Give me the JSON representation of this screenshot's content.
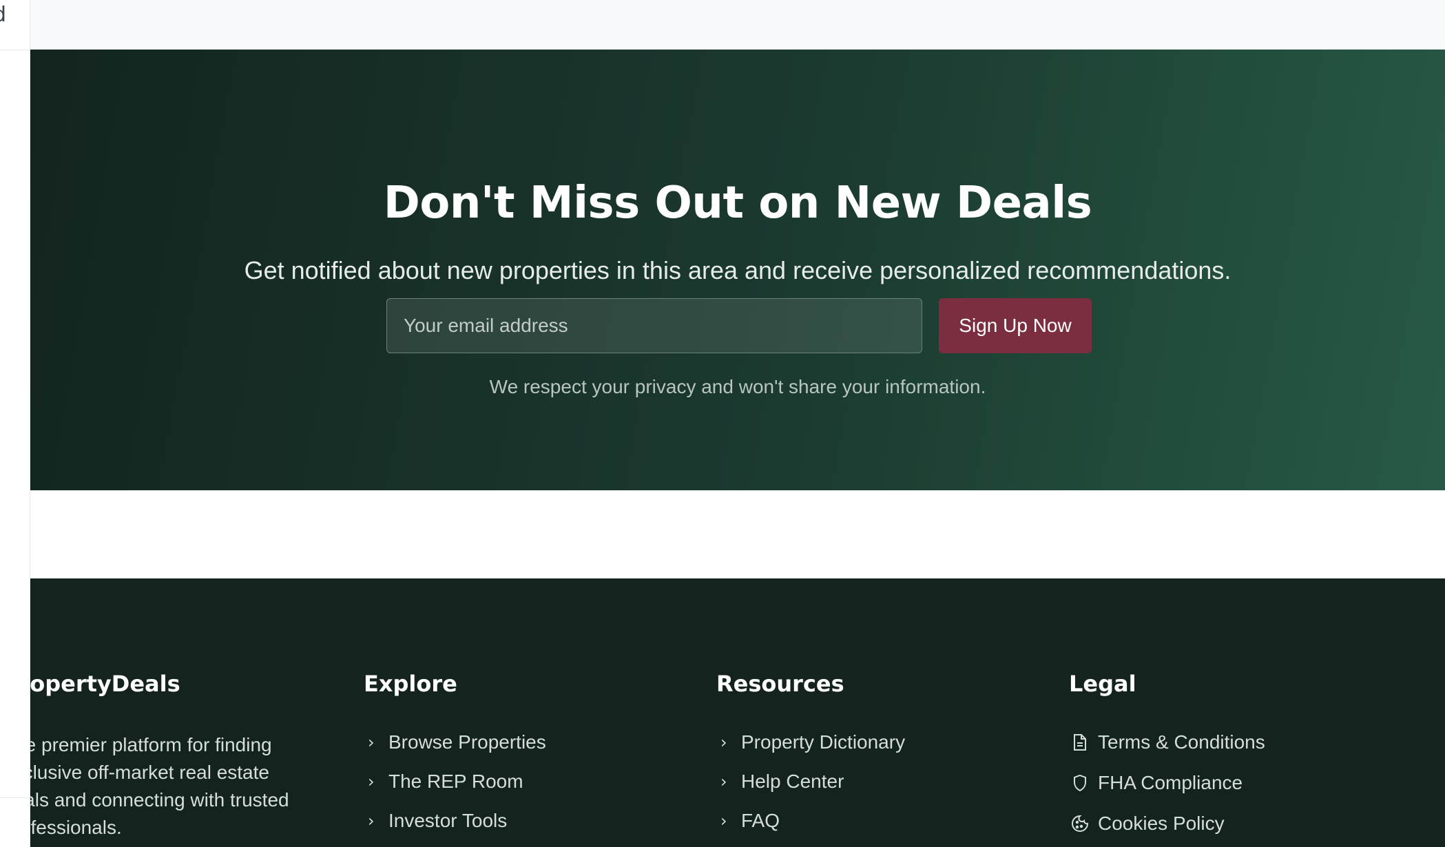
{
  "cta": {
    "title": "Don't Miss Out on New Deals",
    "subtitle": "Get notified about new properties in this area and receive personalized recommendations.",
    "email_placeholder": "Your email address",
    "signup_label": "Sign Up Now",
    "privacy_note": "We respect your privacy and won't share your information."
  },
  "footer": {
    "brand": {
      "name": "PropertyDeals",
      "description": "The premier platform for finding exclusive off-market real estate deals and connecting with trusted professionals."
    },
    "explore": {
      "heading": "Explore",
      "links": [
        "Browse Properties",
        "The REP Room",
        "Investor Tools"
      ]
    },
    "resources": {
      "heading": "Resources",
      "links": [
        "Property Dictionary",
        "Help Center",
        "FAQ"
      ]
    },
    "legal": {
      "heading": "Legal",
      "links": [
        {
          "label": "Terms & Conditions",
          "icon": "document-icon"
        },
        {
          "label": "FHA Compliance",
          "icon": "shield-icon"
        },
        {
          "label": "Cookies Policy",
          "icon": "cookie-icon"
        }
      ]
    }
  },
  "colors": {
    "cta_gradient_start": "#13241e",
    "cta_gradient_end": "#275a45",
    "signup_button": "#7b2e3f",
    "footer_bg": "#14231e"
  }
}
